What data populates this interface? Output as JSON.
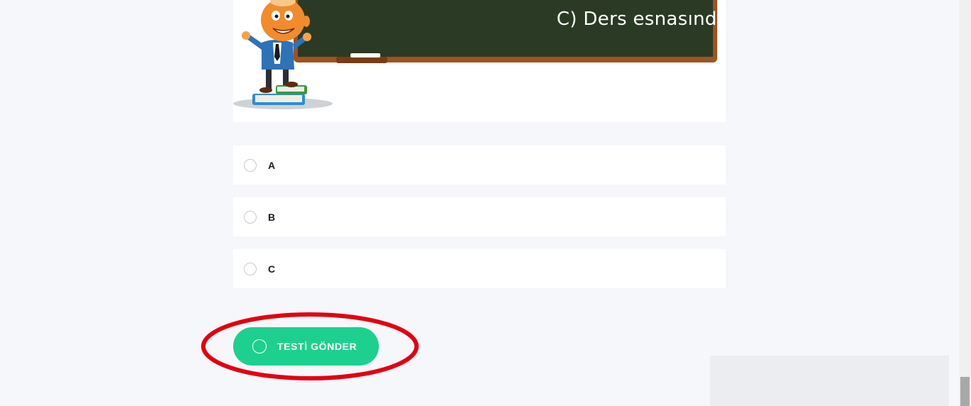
{
  "question": {
    "board_text": "C)  Ders esnasında konuşmayalım."
  },
  "options": [
    {
      "label": "A"
    },
    {
      "label": "B"
    },
    {
      "label": "C"
    }
  ],
  "submit": {
    "label": "TESTİ GÖNDER"
  },
  "colors": {
    "accent": "#1dd08f",
    "annotation": "#e3000f",
    "board": "#2a3a24",
    "background": "#f6f7fb"
  }
}
